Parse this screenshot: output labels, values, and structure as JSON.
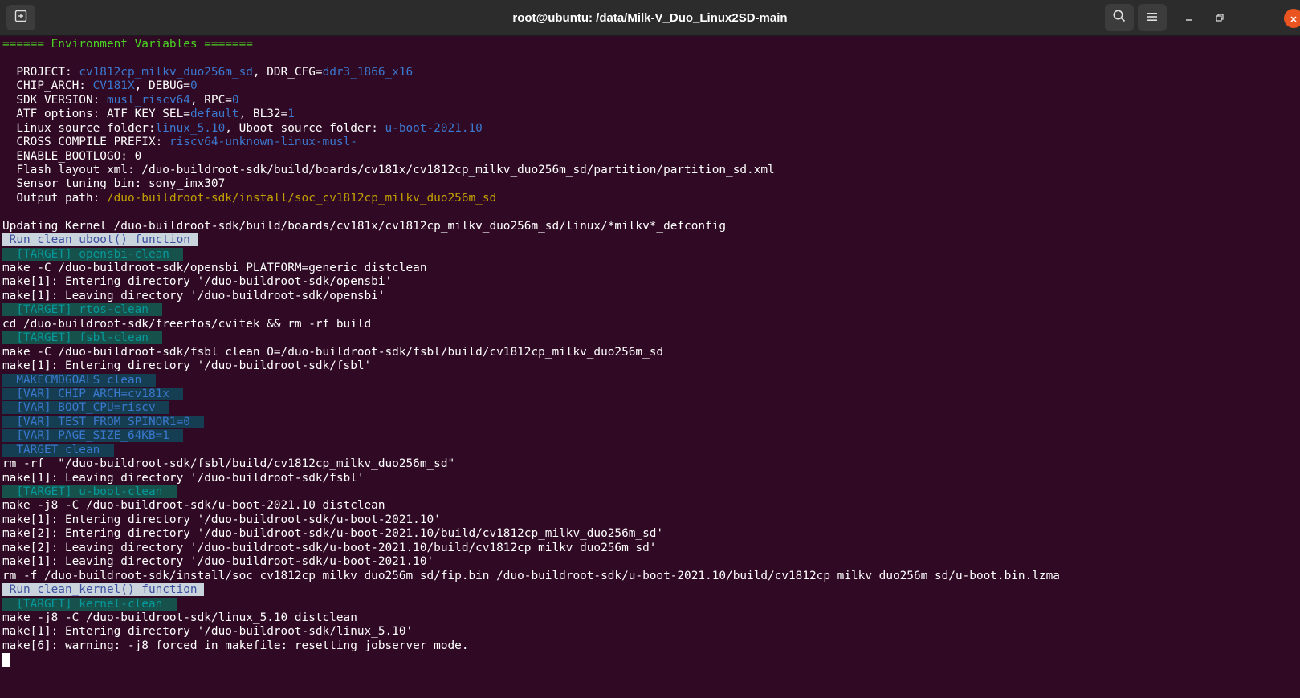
{
  "window": {
    "title": "root@ubuntu: /data/Milk-V_Duo_Linux2SD-main",
    "icons": {
      "new_tab": "new-tab-icon",
      "search": "search-icon",
      "menu": "hamburger-menu-icon",
      "minimize": "minimize-icon",
      "restore": "restore-icon",
      "close": "close-icon"
    }
  },
  "colors": {
    "background": "#300a24",
    "titlebar": "#2c2c2c",
    "text": "#ffffff",
    "green": "#4bd323",
    "blue": "#3b78cf",
    "yellow": "#c2a000",
    "cyan": "#06989a",
    "close": "#e95420"
  },
  "terminal": {
    "header": "====== Environment Variables =======",
    "env": {
      "project_key": "  PROJECT: ",
      "project_val": "cv1812cp_milkv_duo256m_sd",
      "ddr_key": ", DDR_CFG=",
      "ddr_val": "ddr3_1866_x16",
      "chip_key": "  CHIP_ARCH: ",
      "chip_val": "CV181X",
      "debug_key": ", DEBUG=",
      "debug_val": "0",
      "sdk_key": "  SDK VERSION: ",
      "sdk_val": "musl_riscv64",
      "rpc_key": ", RPC=",
      "rpc_val": "0",
      "atf_key": "  ATF options: ATF_KEY_SEL=",
      "atf_val": "default",
      "bl32_key": ", BL32=",
      "bl32_val": "1",
      "linux_key": "  Linux source folder:",
      "linux_val": "linux_5.10",
      "uboot_key": ", Uboot source folder: ",
      "uboot_val": "u-boot-2021.10",
      "cross_key": "  CROSS_COMPILE_PREFIX: ",
      "cross_val": "riscv64-unknown-linux-musl-",
      "bootlogo": "  ENABLE_BOOTLOGO: 0",
      "flash": "  Flash layout xml: /duo-buildroot-sdk/build/boards/cv181x/cv1812cp_milkv_duo256m_sd/partition/partition_sd.xml",
      "sensor": "  Sensor tuning bin: sony_imx307",
      "output_key": "  Output path: ",
      "output_val": "/duo-buildroot-sdk/install/soc_cv1812cp_milkv_duo256m_sd"
    },
    "log": [
      {
        "t": "plain",
        "text": "Updating Kernel /duo-buildroot-sdk/build/boards/cv181x/cv1812cp_milkv_duo256m_sd/linux/*milkv*_defconfig"
      },
      {
        "t": "run",
        "text": " Run clean_uboot() function "
      },
      {
        "t": "target",
        "text": "  [TARGET] opensbi-clean  "
      },
      {
        "t": "plain",
        "text": "make -C /duo-buildroot-sdk/opensbi PLATFORM=generic distclean"
      },
      {
        "t": "plain",
        "text": "make[1]: Entering directory '/duo-buildroot-sdk/opensbi'"
      },
      {
        "t": "plain",
        "text": "make[1]: Leaving directory '/duo-buildroot-sdk/opensbi'"
      },
      {
        "t": "target",
        "text": "  [TARGET] rtos-clean  "
      },
      {
        "t": "plain",
        "text": "cd /duo-buildroot-sdk/freertos/cvitek && rm -rf build"
      },
      {
        "t": "target",
        "text": "  [TARGET] fsbl-clean  "
      },
      {
        "t": "plain",
        "text": "make -C /duo-buildroot-sdk/fsbl clean O=/duo-buildroot-sdk/fsbl/build/cv1812cp_milkv_duo256m_sd"
      },
      {
        "t": "plain",
        "text": "make[1]: Entering directory '/duo-buildroot-sdk/fsbl'"
      },
      {
        "t": "var",
        "text": "  MAKECMDGOALS clean  "
      },
      {
        "t": "var",
        "text": "  [VAR] CHIP_ARCH=cv181x  "
      },
      {
        "t": "var",
        "text": "  [VAR] BOOT_CPU=riscv  "
      },
      {
        "t": "var",
        "text": "  [VAR] TEST_FROM_SPINOR1=0  "
      },
      {
        "t": "var",
        "text": "  [VAR] PAGE_SIZE_64KB=1  "
      },
      {
        "t": "var",
        "text": "  TARGET clean  "
      },
      {
        "t": "plain",
        "text": "rm -rf  \"/duo-buildroot-sdk/fsbl/build/cv1812cp_milkv_duo256m_sd\""
      },
      {
        "t": "plain",
        "text": "make[1]: Leaving directory '/duo-buildroot-sdk/fsbl'"
      },
      {
        "t": "target",
        "text": "  [TARGET] u-boot-clean  "
      },
      {
        "t": "plain",
        "text": "make -j8 -C /duo-buildroot-sdk/u-boot-2021.10 distclean"
      },
      {
        "t": "plain",
        "text": "make[1]: Entering directory '/duo-buildroot-sdk/u-boot-2021.10'"
      },
      {
        "t": "plain",
        "text": "make[2]: Entering directory '/duo-buildroot-sdk/u-boot-2021.10/build/cv1812cp_milkv_duo256m_sd'"
      },
      {
        "t": "plain",
        "text": "make[2]: Leaving directory '/duo-buildroot-sdk/u-boot-2021.10/build/cv1812cp_milkv_duo256m_sd'"
      },
      {
        "t": "plain",
        "text": "make[1]: Leaving directory '/duo-buildroot-sdk/u-boot-2021.10'"
      },
      {
        "t": "plain",
        "text": "rm -f /duo-buildroot-sdk/install/soc_cv1812cp_milkv_duo256m_sd/fip.bin /duo-buildroot-sdk/u-boot-2021.10/build/cv1812cp_milkv_duo256m_sd/u-boot.bin.lzma"
      },
      {
        "t": "run",
        "text": " Run clean_kernel() function "
      },
      {
        "t": "target",
        "text": "  [TARGET] kernel-clean  "
      },
      {
        "t": "plain",
        "text": "make -j8 -C /duo-buildroot-sdk/linux_5.10 distclean"
      },
      {
        "t": "plain",
        "text": "make[1]: Entering directory '/duo-buildroot-sdk/linux_5.10'"
      },
      {
        "t": "plain",
        "text": "make[6]: warning: -j8 forced in makefile: resetting jobserver mode."
      }
    ]
  }
}
